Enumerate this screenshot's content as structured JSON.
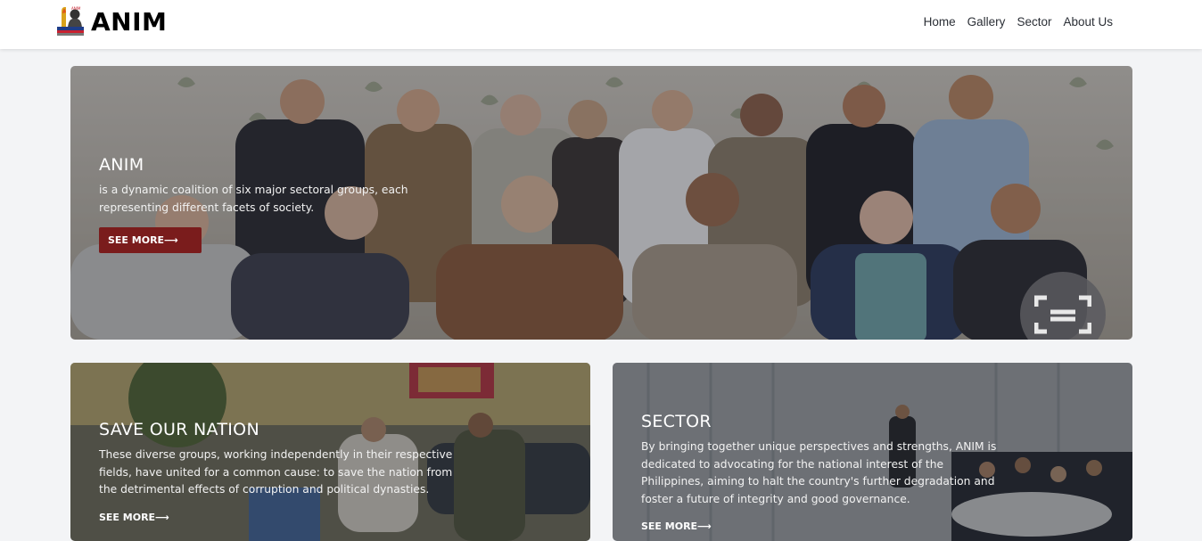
{
  "brand": {
    "logo_label": "ANIM",
    "name": "ANIM"
  },
  "nav": {
    "items": [
      {
        "label": "Home"
      },
      {
        "label": "Gallery"
      },
      {
        "label": "Sector"
      },
      {
        "label": "About Us"
      }
    ]
  },
  "hero": {
    "title": "ANIM",
    "description": "is a dynamic coalition of six major sectoral groups, each representing different facets of society.",
    "button_label": "SEE MORE⟶",
    "accent_color": "#7a1c1c",
    "scan_icon": "scan-icon"
  },
  "cards": [
    {
      "title": "SAVE OUR NATION",
      "description": "These diverse groups, working independently in their respective fields, have united for a common cause: to save the nation from the detrimental effects of corruption and political dynasties.",
      "link_label": "SEE MORE⟶"
    },
    {
      "title": "SECTOR",
      "description": "By bringing together unique perspectives and strengths, ANIM is dedicated to advocating for the national interest of the Philippines, aiming to halt the country's further degradation and foster a future of integrity and good governance.",
      "link_label": "SEE MORE⟶"
    }
  ]
}
